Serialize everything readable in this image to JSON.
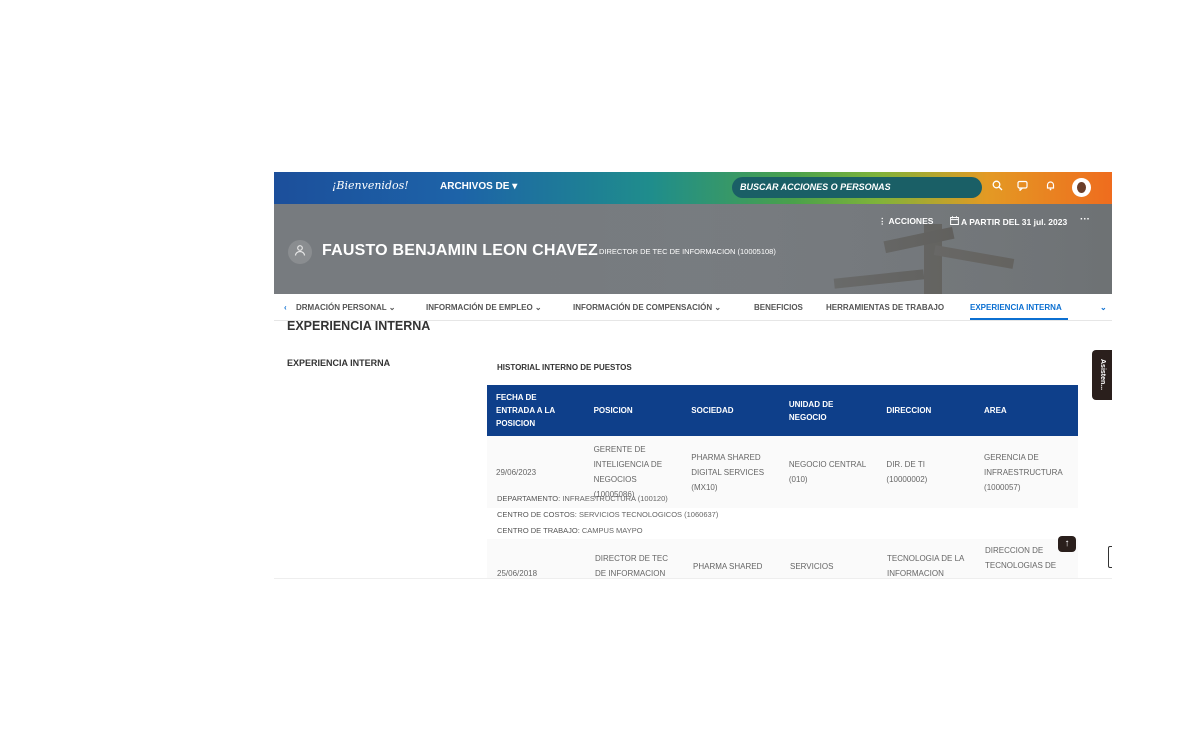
{
  "topnav": {
    "logo": "¡Bienvenidos!",
    "archivos": "ARCHIVOS DE ▾",
    "search_placeholder": "BUSCAR ACCIONES O PERSONAS",
    "icons": [
      "search-icon",
      "chat-icon",
      "bell-icon",
      "avatar"
    ]
  },
  "header": {
    "acciones": "⋮ ACCIONES",
    "a_partir": "A PARTIR DEL 31 jul. 2023",
    "more": "···",
    "name": "FAUSTO BENJAMIN LEON CHAVEZ",
    "role": "DIRECTOR DE TEC DE INFORMACION (10005108)"
  },
  "tabs": [
    {
      "label": "DRMACIÓN PERSONAL ⌄"
    },
    {
      "label": "INFORMACIÓN DE EMPLEO ⌄"
    },
    {
      "label": "INFORMACIÓN DE COMPENSACIÓN ⌄"
    },
    {
      "label": "BENEFICIOS"
    },
    {
      "label": "HERRAMIENTAS DE TRABAJO"
    },
    {
      "label": "EXPERIENCIA INTERNA"
    }
  ],
  "content": {
    "section_title": "EXPERIENCIA INTERNA",
    "left_label": "EXPERIENCIA INTERNA",
    "hist_title": "HISTORIAL INTERNO DE PUESTOS",
    "side_tab": "Asisten..."
  },
  "table": {
    "headers": [
      "FECHA DE ENTRADA A LA POSICION",
      "POSICION",
      "SOCIEDAD",
      "UNIDAD DE NEGOCIO",
      "DIRECCION",
      "AREA"
    ],
    "row1": [
      "29/06/2023",
      "GERENTE DE INTELIGENCIA DE NEGOCIOS (10005086)",
      "PHARMA SHARED DIGITAL SERVICES (MX10)",
      "NEGOCIO CENTRAL (010)",
      "DIR. DE TI (10000002)",
      "GERENCIA DE INFRAESTRUCTURA (1000057)"
    ],
    "meta": [
      {
        "label": "DEPARTAMENTO:",
        "value": "INFRAESTRUCTURA (100120)"
      },
      {
        "label": "CENTRO DE COSTOS:",
        "value": "SERVICIOS TECNOLOGICOS (1060637)"
      },
      {
        "label": "CENTRO DE TRABAJO:",
        "value": "CAMPUS MAYPO"
      }
    ],
    "row2": [
      "25/06/2018",
      "DIRECTOR DE TEC DE INFORMACION",
      "PHARMA SHARED",
      "SERVICIOS",
      "TECNOLOGIA DE LA INFORMACION",
      "DIRECCION DE TECNOLOGIAS DE"
    ]
  },
  "colors": {
    "header_blue": "#0e3f8a",
    "active_tab": "#0b6fd1"
  }
}
